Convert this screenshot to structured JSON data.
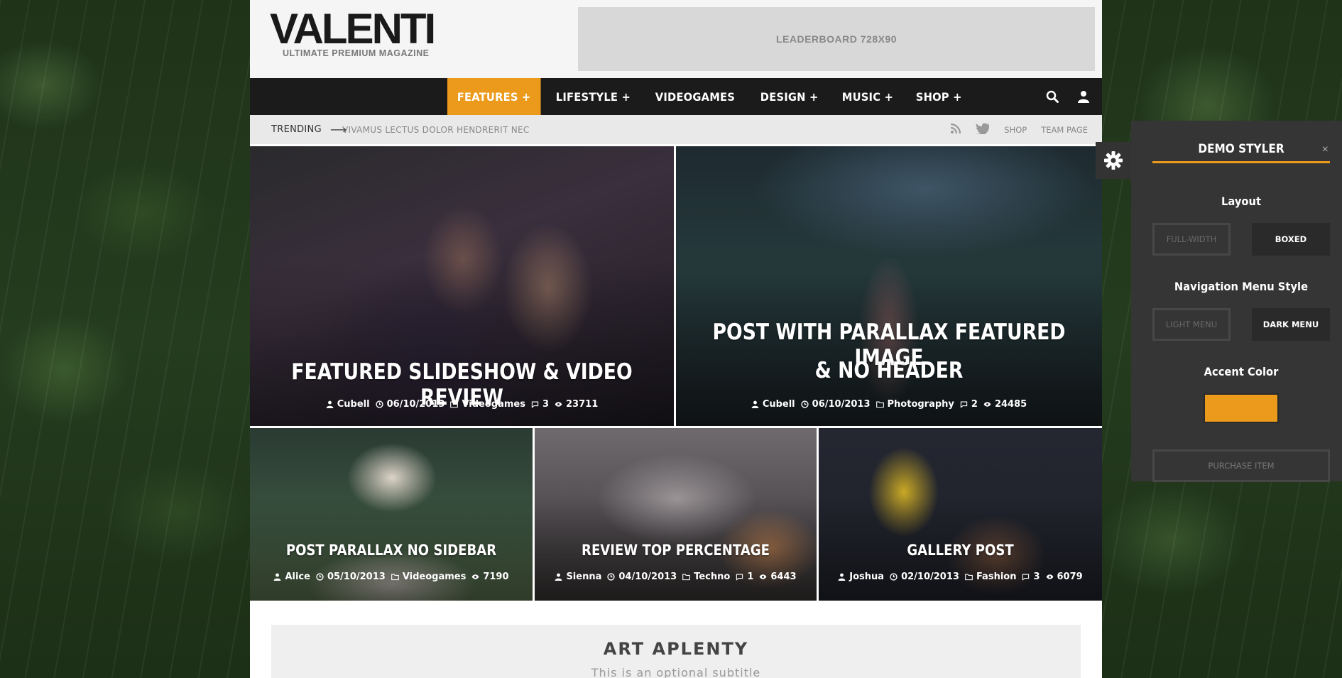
{
  "colors": {
    "accent": "#ec9a1b",
    "nav_bg": "#1b1b1b",
    "panel_bg": "#353535"
  },
  "header": {
    "logo_title": "VALENTI",
    "logo_subtitle": "ULTIMATE PREMIUM MAGAZINE",
    "ad_label": "LEADERBOARD 728X90"
  },
  "nav": {
    "items": [
      {
        "label": "FEATURES +",
        "active": true
      },
      {
        "label": "LIFESTYLE +"
      },
      {
        "label": "VIDEOGAMES"
      },
      {
        "label": "DESIGN +"
      },
      {
        "label": "MUSIC +"
      },
      {
        "label": "SHOP +"
      }
    ],
    "icons": [
      "search-icon",
      "user-icon"
    ]
  },
  "trending": {
    "label": "TRENDING",
    "headline": "VIVAMUS LECTUS DOLOR HENDRERIT NEC",
    "links": [
      "SHOP",
      "TEAM PAGE"
    ],
    "icons": [
      "rss-icon",
      "twitter-icon"
    ]
  },
  "posts": [
    {
      "title": "FEATURED SLIDESHOW & VIDEO REVIEW",
      "author": "Cubell",
      "date": "06/10/2013",
      "category": "Videogames",
      "comments": "3",
      "views": "23711"
    },
    {
      "title_line1": "POST WITH PARALLAX FEATURED IMAGE",
      "title_line2": "& NO HEADER",
      "author": "Cubell",
      "date": "06/10/2013",
      "category": "Photography",
      "comments": "2",
      "views": "24485"
    },
    {
      "title": "POST PARALLAX NO SIDEBAR",
      "author": "Alice",
      "date": "05/10/2013",
      "category": "Videogames",
      "views": "7190"
    },
    {
      "title": "REVIEW TOP PERCENTAGE",
      "author": "Sienna",
      "date": "04/10/2013",
      "category": "Techno",
      "comments": "1",
      "views": "6443"
    },
    {
      "title": "GALLERY POST",
      "author": "Joshua",
      "date": "02/10/2013",
      "category": "Fashion",
      "comments": "3",
      "views": "6079"
    }
  ],
  "section": {
    "title": "ART APLENTY",
    "subtitle": "This is an optional subtitle"
  },
  "styler": {
    "title": "DEMO STYLER",
    "close": "×",
    "layout_label": "Layout",
    "layout_options": [
      "FULL-WIDTH",
      "BOXED"
    ],
    "nav_label": "Navigation Menu Style",
    "nav_options": [
      "LIGHT MENU",
      "DARK MENU"
    ],
    "accent_label": "Accent Color",
    "purchase": "PURCHASE ITEM"
  }
}
